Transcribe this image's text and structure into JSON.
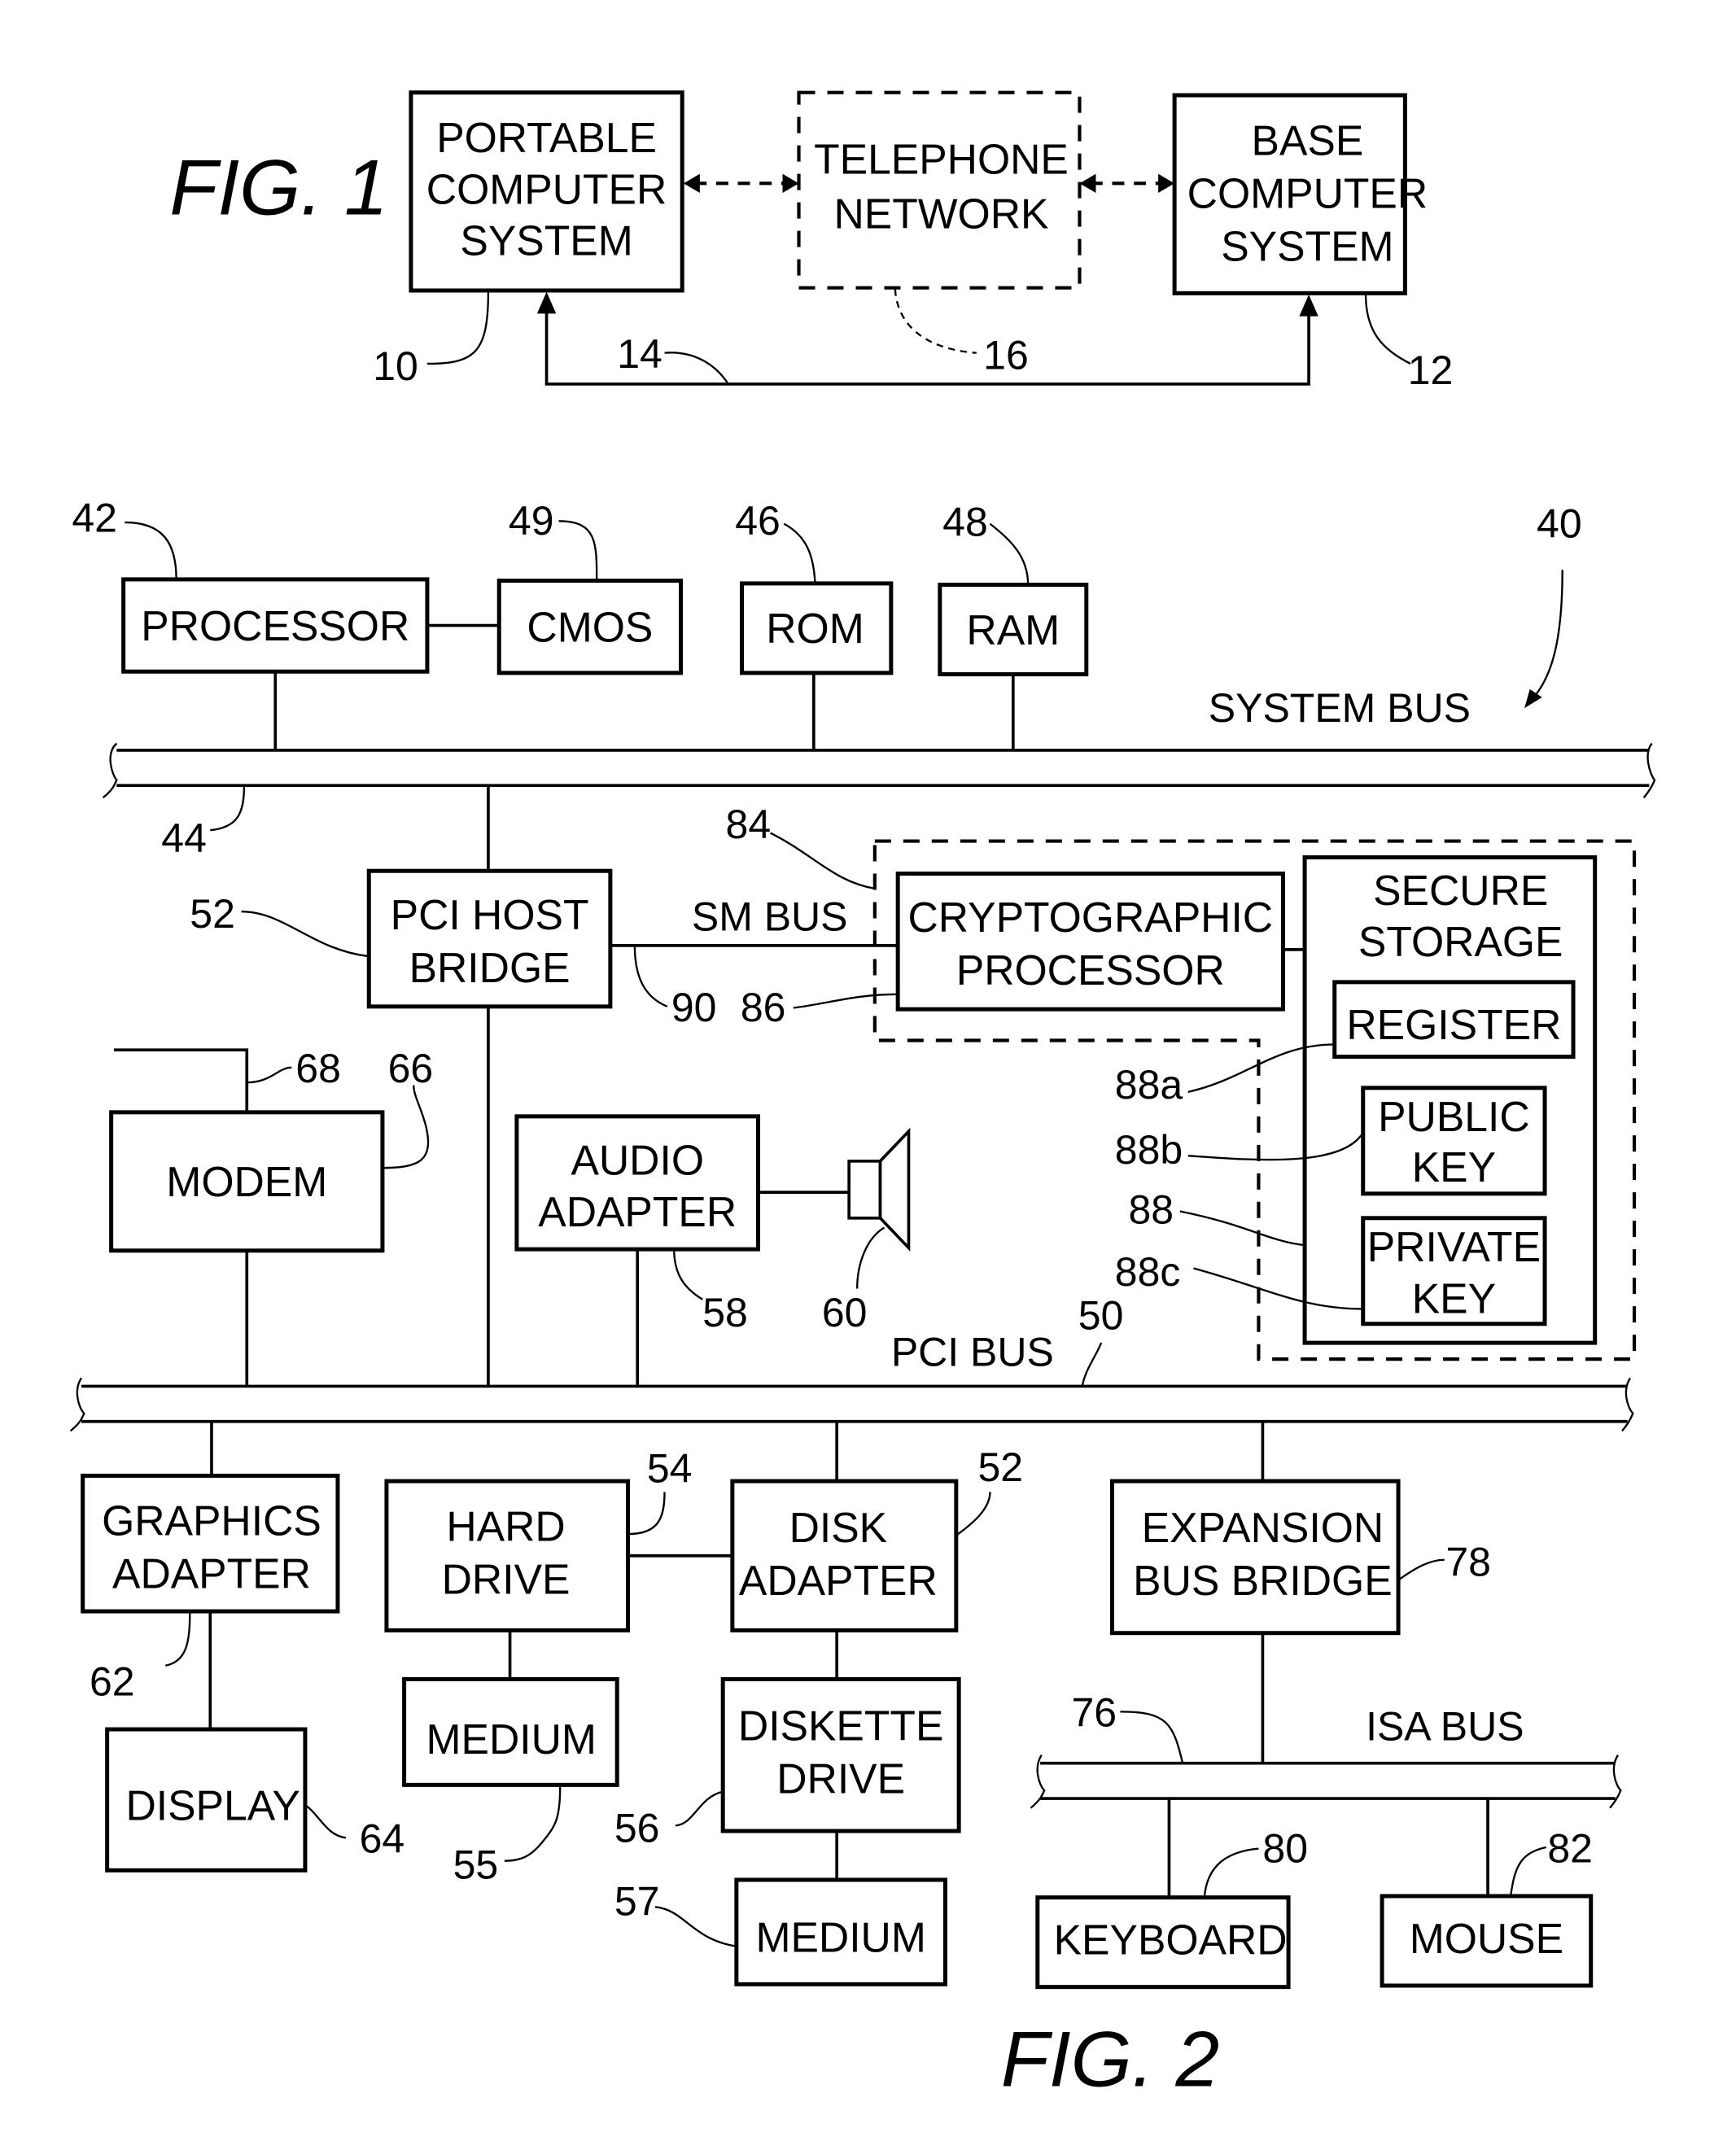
{
  "fig1": {
    "title": "FIG. 1",
    "portable": [
      "PORTABLE",
      "COMPUTER",
      "SYSTEM"
    ],
    "telephone": [
      "TELEPHONE",
      "NETWORK"
    ],
    "base": [
      "BASE",
      "COMPUTER",
      "SYSTEM"
    ],
    "refs": {
      "portable": "10",
      "base": "12",
      "link": "14",
      "network": "16"
    }
  },
  "fig2": {
    "title": "FIG. 2",
    "system_ref": "40",
    "system_bus": {
      "label": "SYSTEM BUS",
      "ref": "44"
    },
    "pci_bus": {
      "label": "PCI BUS",
      "ref": "50"
    },
    "isa_bus": {
      "label": "ISA BUS",
      "ref": "76"
    },
    "sm_bus": {
      "label": "SM  BUS",
      "ref": "90"
    },
    "blocks": {
      "processor": {
        "label": [
          "PROCESSOR"
        ],
        "ref": "42"
      },
      "cmos": {
        "label": [
          "CMOS"
        ],
        "ref": "49"
      },
      "rom": {
        "label": [
          "ROM"
        ],
        "ref": "46"
      },
      "ram": {
        "label": [
          "RAM"
        ],
        "ref": "48"
      },
      "pci_host_bridge": {
        "label": [
          "PCI HOST",
          "BRIDGE"
        ],
        "ref": "52"
      },
      "crypto": {
        "label": [
          "CRYPTOGRAPHIC",
          "PROCESSOR"
        ],
        "ref": "86",
        "group_ref": "84"
      },
      "secure_storage": {
        "label": [
          "SECURE",
          "STORAGE"
        ],
        "ref": "88"
      },
      "register": {
        "label": [
          "REGISTER"
        ],
        "ref": "88a"
      },
      "public_key": {
        "label": [
          "PUBLIC",
          "KEY"
        ],
        "ref": "88b"
      },
      "private_key": {
        "label": [
          "PRIVATE",
          "KEY"
        ],
        "ref": "88c"
      },
      "modem": {
        "label": [
          "MODEM"
        ],
        "ref": "66",
        "line_ref": "68"
      },
      "audio": {
        "label": [
          "AUDIO",
          "ADAPTER"
        ],
        "ref": "58",
        "speaker_ref": "60"
      },
      "graphics": {
        "label": [
          "GRAPHICS",
          "ADAPTER"
        ],
        "ref": "62"
      },
      "display": {
        "label": [
          "DISPLAY"
        ],
        "ref": "64"
      },
      "hard_drive": {
        "label": [
          "HARD",
          "DRIVE"
        ],
        "ref": "54"
      },
      "medium1": {
        "label": [
          "MEDIUM"
        ],
        "ref": "55"
      },
      "disk_adapter": {
        "label": [
          "DISK",
          "ADAPTER"
        ],
        "ref": "52"
      },
      "diskette": {
        "label": [
          "DISKETTE",
          "DRIVE"
        ],
        "ref": "56"
      },
      "medium2": {
        "label": [
          "MEDIUM"
        ],
        "ref": "57"
      },
      "expansion": {
        "label": [
          "EXPANSION",
          "BUS BRIDGE"
        ],
        "ref": "78"
      },
      "keyboard": {
        "label": [
          "KEYBOARD"
        ],
        "ref": "80"
      },
      "mouse": {
        "label": [
          "MOUSE"
        ],
        "ref": "82"
      }
    }
  }
}
